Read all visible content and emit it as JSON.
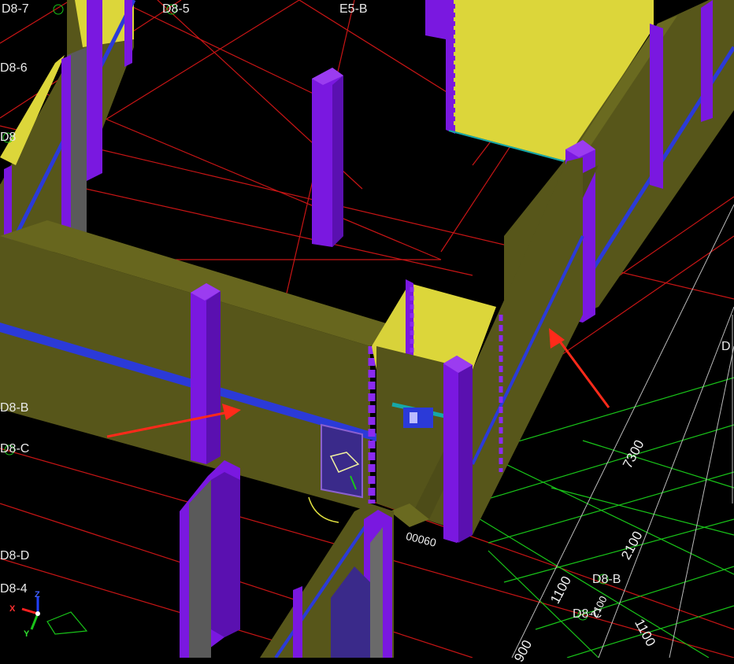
{
  "viewport": {
    "background": "#000000",
    "grid_labels": [
      "D8-7",
      "D8-5",
      "E5-B",
      "D8-6",
      "D8",
      "D8-B",
      "D8-C",
      "D8-D",
      "D8-4",
      "D8-B",
      "D8-C",
      "D"
    ],
    "dimension_labels": [
      "7300",
      "2100",
      "1100",
      "1100",
      "900",
      "00060",
      "2100"
    ],
    "axis_gizmo": {
      "x": "X",
      "y": "Y",
      "z": "Z"
    },
    "colors": {
      "wall_olive": "#57561a",
      "wall_olive_dark": "#4a4916",
      "wall_top_yellow": "#dcd63a",
      "column_purple": "#7a18e0",
      "column_purple_dark": "#5a10b0",
      "blue_band": "#2b3ad8",
      "grid_red": "#d01818",
      "grid_green": "#18c818",
      "annotation_arrow": "#ff2a1a",
      "teal": "#16a8a8"
    }
  }
}
